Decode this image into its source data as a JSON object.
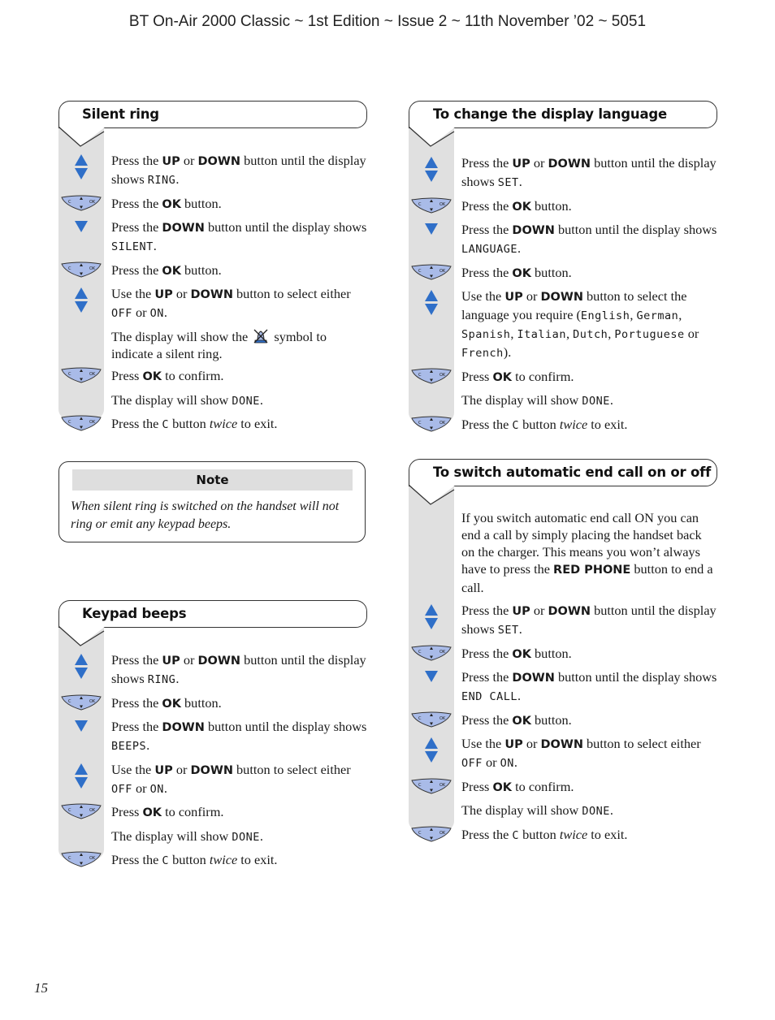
{
  "header": {
    "title": "BT On-Air 2000 Classic ~ 1st Edition ~ Issue 2 ~ 11th November ’02 ~ 5051"
  },
  "page_number": "15",
  "colors": {
    "arrow_blue": "#2f6fc8",
    "button_fill": "#a9bbe8",
    "strip_gray": "#e0e0e0",
    "note_header_gray": "#dedede"
  },
  "icons": {
    "updown": "up-down-arrows-icon",
    "down": "down-arrow-icon",
    "okpad": "c-ok-navigation-button-icon",
    "silent": "silent-ring-bell-icon"
  },
  "sections": {
    "silent_ring": {
      "title": "Silent ring",
      "steps": [
        {
          "icon": "updown",
          "parts": [
            [
              "t",
              "Press the "
            ],
            [
              "b",
              "UP"
            ],
            [
              "t",
              " or "
            ],
            [
              "b",
              "DOWN"
            ],
            [
              "t",
              " button until the display shows "
            ],
            [
              "m",
              "RING"
            ],
            [
              "t",
              "."
            ]
          ]
        },
        {
          "icon": "okpad",
          "parts": [
            [
              "t",
              "Press the "
            ],
            [
              "b",
              "OK"
            ],
            [
              "t",
              " button."
            ]
          ]
        },
        {
          "icon": "down",
          "parts": [
            [
              "t",
              "Press the "
            ],
            [
              "b",
              "DOWN"
            ],
            [
              "t",
              " button until the display shows "
            ],
            [
              "m",
              "SILENT"
            ],
            [
              "t",
              "."
            ]
          ]
        },
        {
          "icon": "okpad",
          "parts": [
            [
              "t",
              "Press the "
            ],
            [
              "b",
              "OK"
            ],
            [
              "t",
              " button."
            ]
          ]
        },
        {
          "icon": "updown",
          "parts": [
            [
              "t",
              "Use the "
            ],
            [
              "b",
              "UP"
            ],
            [
              "t",
              " or "
            ],
            [
              "b",
              "DOWN"
            ],
            [
              "t",
              " button to select either "
            ],
            [
              "m",
              "OFF"
            ],
            [
              "t",
              " or "
            ],
            [
              "m",
              "ON"
            ],
            [
              "t",
              "."
            ]
          ]
        },
        {
          "icon": "none",
          "parts": [
            [
              "t",
              "The display will show the "
            ],
            [
              "sym",
              "silent"
            ],
            [
              "t",
              " symbol to indicate a silent ring."
            ]
          ]
        },
        {
          "icon": "okpad",
          "parts": [
            [
              "t",
              "Press "
            ],
            [
              "b",
              "OK"
            ],
            [
              "t",
              " to confirm."
            ]
          ]
        },
        {
          "icon": "none",
          "parts": [
            [
              "t",
              "The display will show "
            ],
            [
              "m",
              "DONE"
            ],
            [
              "t",
              "."
            ]
          ]
        },
        {
          "icon": "okpad",
          "parts": [
            [
              "t",
              "Press the "
            ],
            [
              "m",
              "C"
            ],
            [
              "t",
              " button "
            ],
            [
              "i",
              "twice"
            ],
            [
              "t",
              " to exit."
            ]
          ]
        }
      ]
    },
    "display_language": {
      "title": "To change the display language",
      "steps": [
        {
          "icon": "updown",
          "parts": [
            [
              "t",
              "Press the "
            ],
            [
              "b",
              "UP"
            ],
            [
              "t",
              " or "
            ],
            [
              "b",
              "DOWN"
            ],
            [
              "t",
              " button until the display shows "
            ],
            [
              "m",
              "SET"
            ],
            [
              "t",
              "."
            ]
          ]
        },
        {
          "icon": "okpad",
          "parts": [
            [
              "t",
              "Press the "
            ],
            [
              "b",
              "OK"
            ],
            [
              "t",
              " button."
            ]
          ]
        },
        {
          "icon": "down",
          "parts": [
            [
              "t",
              "Press the "
            ],
            [
              "b",
              "DOWN"
            ],
            [
              "t",
              " button until the display shows "
            ],
            [
              "m",
              "LANGUAGE"
            ],
            [
              "t",
              "."
            ]
          ]
        },
        {
          "icon": "okpad",
          "parts": [
            [
              "t",
              "Press the "
            ],
            [
              "b",
              "OK"
            ],
            [
              "t",
              " button."
            ]
          ]
        },
        {
          "icon": "updown",
          "parts": [
            [
              "t",
              "Use the "
            ],
            [
              "b",
              "UP"
            ],
            [
              "t",
              " or "
            ],
            [
              "b",
              "DOWN"
            ],
            [
              "t",
              " button to select the language you require ("
            ],
            [
              "m",
              "English"
            ],
            [
              "t",
              ", "
            ],
            [
              "m",
              "German"
            ],
            [
              "t",
              ", "
            ],
            [
              "m",
              "Spanish"
            ],
            [
              "t",
              ", "
            ],
            [
              "m",
              "Italian"
            ],
            [
              "t",
              ", "
            ],
            [
              "m",
              "Dutch"
            ],
            [
              "t",
              ", "
            ],
            [
              "m",
              "Portuguese"
            ],
            [
              "t",
              " or "
            ],
            [
              "m",
              "French"
            ],
            [
              "t",
              ")."
            ]
          ]
        },
        {
          "icon": "okpad",
          "parts": [
            [
              "t",
              "Press "
            ],
            [
              "b",
              "OK"
            ],
            [
              "t",
              " to confirm."
            ]
          ]
        },
        {
          "icon": "none",
          "parts": [
            [
              "t",
              "The display will show "
            ],
            [
              "m",
              "DONE"
            ],
            [
              "t",
              "."
            ]
          ]
        },
        {
          "icon": "okpad",
          "parts": [
            [
              "t",
              "Press the "
            ],
            [
              "m",
              "C"
            ],
            [
              "t",
              " button "
            ],
            [
              "i",
              "twice"
            ],
            [
              "t",
              " to exit."
            ]
          ]
        }
      ]
    },
    "note": {
      "heading": "Note",
      "body": "When silent ring is switched on the handset will not ring or emit any keypad beeps."
    },
    "end_call": {
      "title": "To switch automatic end call on or off",
      "intro": [
        [
          "t",
          "If you switch automatic end call ON you can end a call by simply placing the handset back on the charger. This means you won’t always have to press the "
        ],
        [
          "b",
          "RED PHONE"
        ],
        [
          "t",
          " button to end a call."
        ]
      ],
      "steps": [
        {
          "icon": "updown",
          "parts": [
            [
              "t",
              "Press the "
            ],
            [
              "b",
              "UP"
            ],
            [
              "t",
              " or "
            ],
            [
              "b",
              "DOWN"
            ],
            [
              "t",
              " button until the display shows "
            ],
            [
              "m",
              "SET"
            ],
            [
              "t",
              "."
            ]
          ]
        },
        {
          "icon": "okpad",
          "parts": [
            [
              "t",
              "Press the "
            ],
            [
              "b",
              "OK"
            ],
            [
              "t",
              " button."
            ]
          ]
        },
        {
          "icon": "down",
          "parts": [
            [
              "t",
              "Press the "
            ],
            [
              "b",
              "DOWN"
            ],
            [
              "t",
              " button until the display shows "
            ],
            [
              "m",
              "END CALL"
            ],
            [
              "t",
              "."
            ]
          ]
        },
        {
          "icon": "okpad",
          "parts": [
            [
              "t",
              "Press the "
            ],
            [
              "b",
              "OK"
            ],
            [
              "t",
              " button."
            ]
          ]
        },
        {
          "icon": "updown",
          "parts": [
            [
              "t",
              "Use the "
            ],
            [
              "b",
              "UP"
            ],
            [
              "t",
              " or "
            ],
            [
              "b",
              "DOWN"
            ],
            [
              "t",
              " button to select either "
            ],
            [
              "m",
              "OFF"
            ],
            [
              "t",
              " or "
            ],
            [
              "m",
              "ON"
            ],
            [
              "t",
              "."
            ]
          ]
        },
        {
          "icon": "okpad",
          "parts": [
            [
              "t",
              "Press "
            ],
            [
              "b",
              "OK"
            ],
            [
              "t",
              " to confirm."
            ]
          ]
        },
        {
          "icon": "none",
          "parts": [
            [
              "t",
              "The display will show "
            ],
            [
              "m",
              "DONE"
            ],
            [
              "t",
              "."
            ]
          ]
        },
        {
          "icon": "okpad",
          "parts": [
            [
              "t",
              "Press the "
            ],
            [
              "m",
              "C"
            ],
            [
              "t",
              " button "
            ],
            [
              "i",
              "twice"
            ],
            [
              "t",
              " to exit."
            ]
          ]
        }
      ]
    },
    "keypad_beeps": {
      "title": "Keypad beeps",
      "steps": [
        {
          "icon": "updown",
          "parts": [
            [
              "t",
              "Press the "
            ],
            [
              "b",
              "UP"
            ],
            [
              "t",
              " or "
            ],
            [
              "b",
              "DOWN"
            ],
            [
              "t",
              " button until the display shows "
            ],
            [
              "m",
              "RING"
            ],
            [
              "t",
              "."
            ]
          ]
        },
        {
          "icon": "okpad",
          "parts": [
            [
              "t",
              "Press the "
            ],
            [
              "b",
              "OK"
            ],
            [
              "t",
              " button."
            ]
          ]
        },
        {
          "icon": "down",
          "parts": [
            [
              "t",
              "Press the "
            ],
            [
              "b",
              "DOWN"
            ],
            [
              "t",
              " button until the display shows "
            ],
            [
              "m",
              "BEEPS"
            ],
            [
              "t",
              "."
            ]
          ]
        },
        {
          "icon": "updown",
          "parts": [
            [
              "t",
              "Use the "
            ],
            [
              "b",
              "UP"
            ],
            [
              "t",
              " or "
            ],
            [
              "b",
              "DOWN"
            ],
            [
              "t",
              " button to select either "
            ],
            [
              "m",
              "OFF"
            ],
            [
              "t",
              " or "
            ],
            [
              "m",
              "ON"
            ],
            [
              "t",
              "."
            ]
          ]
        },
        {
          "icon": "okpad",
          "parts": [
            [
              "t",
              "Press "
            ],
            [
              "b",
              "OK"
            ],
            [
              "t",
              " to confirm."
            ]
          ]
        },
        {
          "icon": "none",
          "parts": [
            [
              "t",
              "The display will show "
            ],
            [
              "m",
              "DONE"
            ],
            [
              "t",
              "."
            ]
          ]
        },
        {
          "icon": "okpad",
          "parts": [
            [
              "t",
              "Press the "
            ],
            [
              "m",
              "C"
            ],
            [
              "t",
              " button "
            ],
            [
              "i",
              "twice"
            ],
            [
              "t",
              " to exit."
            ]
          ]
        }
      ]
    }
  }
}
